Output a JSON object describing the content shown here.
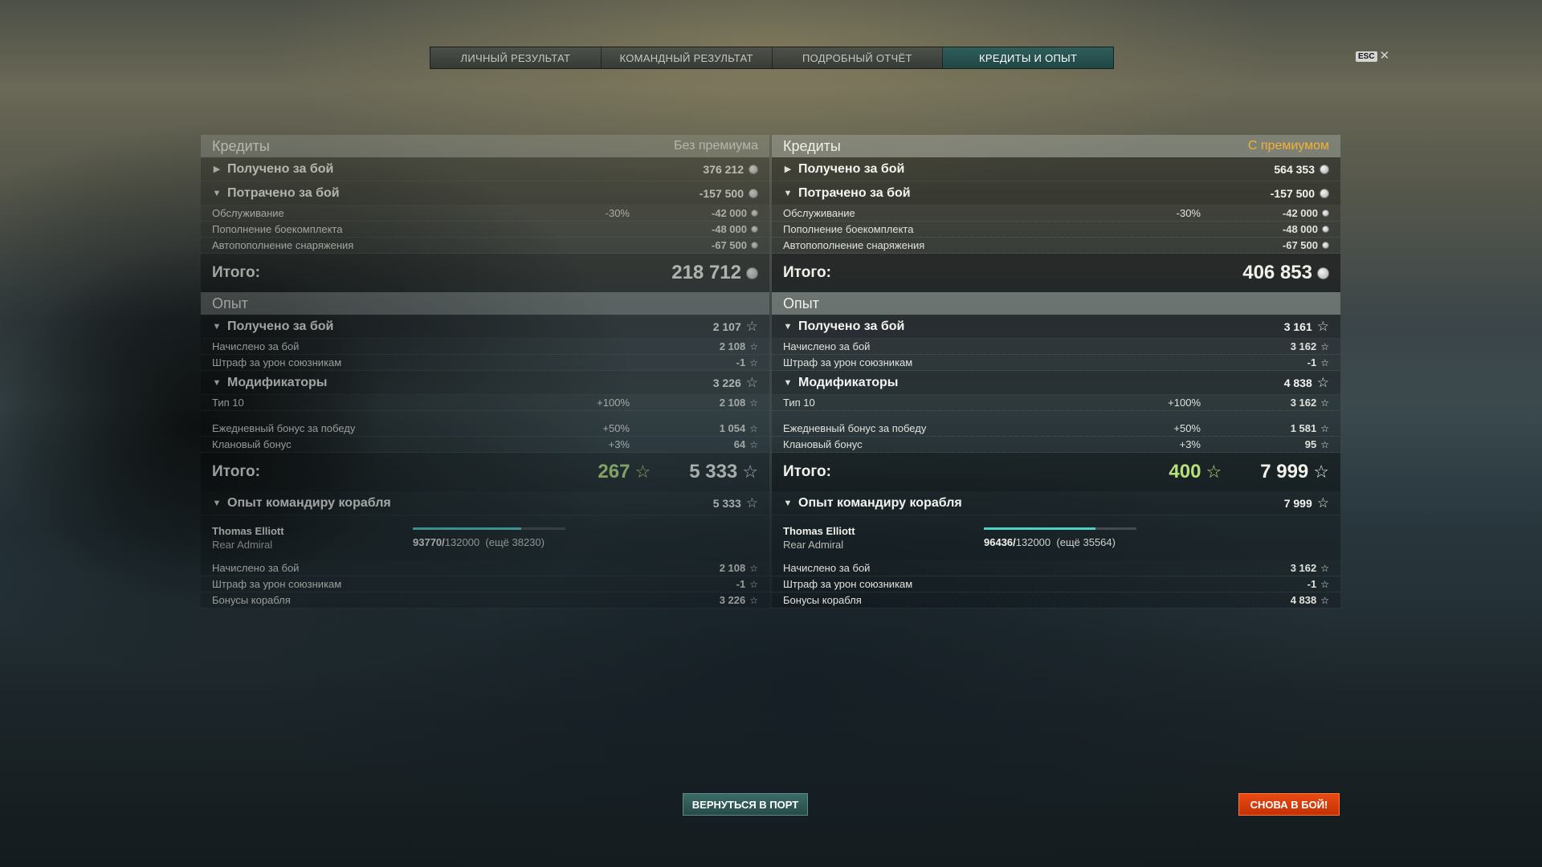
{
  "tabs": [
    {
      "label": "ЛИЧНЫЙ РЕЗУЛЬТАТ"
    },
    {
      "label": "КОМАНДНЫЙ РЕЗУЛЬТАТ"
    },
    {
      "label": "ПОДРОБНЫЙ ОТЧЁТ"
    },
    {
      "label": "КРЕДИТЫ И ОПЫТ"
    }
  ],
  "esc": {
    "key": "ESC",
    "close": "✕"
  },
  "icons": {
    "credits": "coin-icon",
    "xp": "star-icon",
    "expanded": "triangle-down-icon",
    "collapsed": "triangle-right-icon"
  },
  "colors": {
    "accent_tab": "#1f4744",
    "premium": "#f2b233",
    "free_xp": "#b5e07a",
    "battle_button": "#d43c08"
  },
  "left": {
    "credits": {
      "title": "Кредиты",
      "sub": "Без премиума",
      "earned": {
        "label": "Получено за бой",
        "value": "376 212"
      },
      "spent": {
        "label": "Потрачено за бой",
        "value": "-157 500"
      },
      "rows": [
        {
          "label": "Обслуживание",
          "pct": "-30%",
          "value": "-42 000"
        },
        {
          "label": "Пополнение боекомплекта",
          "pct": "",
          "value": "-48 000"
        },
        {
          "label": "Автопополнение снаряжения",
          "pct": "",
          "value": "-67 500"
        }
      ],
      "total": {
        "label": "Итого:",
        "value": "218 712"
      }
    },
    "xp": {
      "title": "Опыт",
      "earned": {
        "label": "Получено за бой",
        "value": "2 107"
      },
      "earned_rows": [
        {
          "label": "Начислено за бой",
          "value": "2 108"
        },
        {
          "label": "Штраф за урон союзникам",
          "value": "-1"
        }
      ],
      "mods": {
        "label": "Модификаторы",
        "value": "3 226"
      },
      "mod_rows": [
        {
          "label": "Тип 10",
          "pct": "+100%",
          "value": "2 108"
        },
        {
          "label": "Ежедневный бонус за победу",
          "pct": "+50%",
          "value": "1 054"
        },
        {
          "label": "Клановый бонус",
          "pct": "+3%",
          "value": "64"
        }
      ],
      "total": {
        "label": "Итого:",
        "free": "267",
        "value": "5 333"
      }
    },
    "commander": {
      "label": "Опыт командиру корабля",
      "value": "5 333",
      "name": "Thomas Elliott",
      "rank": "Rear Admiral",
      "xp_current": "93770/",
      "xp_max": "132000",
      "xp_left": "(ещё 38230)",
      "progress": 0.71,
      "rows": [
        {
          "label": "Начислено за бой",
          "value": "2 108"
        },
        {
          "label": "Штраф за урон союзникам",
          "value": "-1"
        },
        {
          "label": "Бонусы корабля",
          "value": "3 226"
        }
      ]
    }
  },
  "right": {
    "credits": {
      "title": "Кредиты",
      "sub": "С премиумом",
      "earned": {
        "label": "Получено за бой",
        "value": "564 353"
      },
      "spent": {
        "label": "Потрачено за бой",
        "value": "-157 500"
      },
      "rows": [
        {
          "label": "Обслуживание",
          "pct": "-30%",
          "value": "-42 000"
        },
        {
          "label": "Пополнение боекомплекта",
          "pct": "",
          "value": "-48 000"
        },
        {
          "label": "Автопополнение снаряжения",
          "pct": "",
          "value": "-67 500"
        }
      ],
      "total": {
        "label": "Итого:",
        "value": "406 853"
      }
    },
    "xp": {
      "title": "Опыт",
      "earned": {
        "label": "Получено за бой",
        "value": "3 161"
      },
      "earned_rows": [
        {
          "label": "Начислено за бой",
          "value": "3 162"
        },
        {
          "label": "Штраф за урон союзникам",
          "value": "-1"
        }
      ],
      "mods": {
        "label": "Модификаторы",
        "value": "4 838"
      },
      "mod_rows": [
        {
          "label": "Тип 10",
          "pct": "+100%",
          "value": "3 162"
        },
        {
          "label": "Ежедневный бонус за победу",
          "pct": "+50%",
          "value": "1 581"
        },
        {
          "label": "Клановый бонус",
          "pct": "+3%",
          "value": "95"
        }
      ],
      "total": {
        "label": "Итого:",
        "free": "400",
        "value": "7 999"
      }
    },
    "commander": {
      "label": "Опыт командиру корабля",
      "value": "7 999",
      "name": "Thomas Elliott",
      "rank": "Rear Admiral",
      "xp_current": "96436/",
      "xp_max": "132000",
      "xp_left": "(ещё 35564)",
      "progress": 0.73,
      "rows": [
        {
          "label": "Начислено за бой",
          "value": "3 162"
        },
        {
          "label": "Штраф за урон союзникам",
          "value": "-1"
        },
        {
          "label": "Бонусы корабля",
          "value": "4 838"
        }
      ]
    }
  },
  "buttons": {
    "port": "ВЕРНУТЬСЯ В ПОРТ",
    "battle": "СНОВА В БОЙ!"
  }
}
